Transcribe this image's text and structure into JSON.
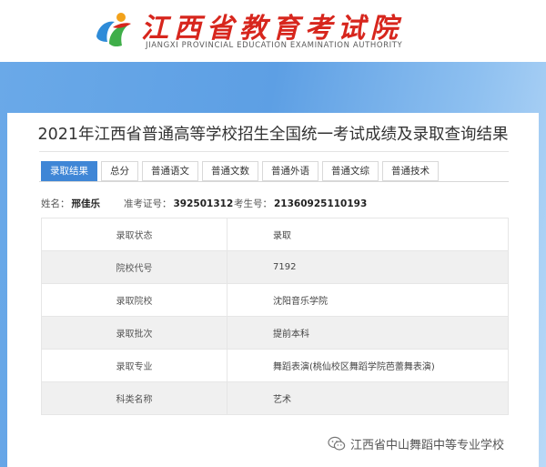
{
  "header": {
    "logo_title": "江西省教育考试院",
    "logo_subtitle": "JIANGXI PROVINCIAL EDUCATION EXAMINATION AUTHORITY"
  },
  "panel": {
    "title": "2021年江西省普通高等学校招生全国统一考试成绩及录取查询结果",
    "tabs": [
      {
        "label": "录取结果",
        "active": true
      },
      {
        "label": "总分",
        "active": false
      },
      {
        "label": "普通语文",
        "active": false
      },
      {
        "label": "普通文数",
        "active": false
      },
      {
        "label": "普通外语",
        "active": false
      },
      {
        "label": "普通文综",
        "active": false
      },
      {
        "label": "普通技术",
        "active": false
      }
    ],
    "student": {
      "name_label": "姓名：",
      "name": "邢佳乐",
      "admission_label": "准考证号：",
      "admission_no": "392501312",
      "exam_label": "考生号：",
      "exam_no": "21360925110193"
    },
    "results": [
      {
        "label": "录取状态",
        "value": "录取"
      },
      {
        "label": "院校代号",
        "value": "7192"
      },
      {
        "label": "录取院校",
        "value": "沈阳音乐学院"
      },
      {
        "label": "录取批次",
        "value": "提前本科"
      },
      {
        "label": "录取专业",
        "value": "舞蹈表演(桃仙校区舞蹈学院芭蕾舞表演)"
      },
      {
        "label": "科类名称",
        "value": "艺术"
      }
    ]
  },
  "watermark": {
    "icon": "wechat-icon",
    "text": "江西省中山舞蹈中等专业学校"
  },
  "colors": {
    "logo_red": "#d7261d",
    "tab_active": "#3f86d6",
    "banner_blue": "#5d9fe4"
  }
}
